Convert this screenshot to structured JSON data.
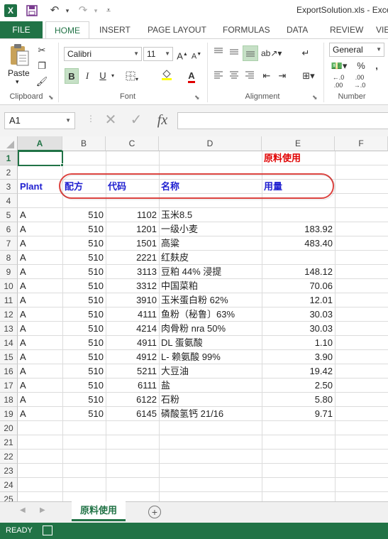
{
  "app": {
    "logo_text": "X",
    "title": "ExportSolution.xls - Excel"
  },
  "ribbon_tabs": [
    "FILE",
    "HOME",
    "INSERT",
    "PAGE LAYOUT",
    "FORMULAS",
    "DATA",
    "REVIEW",
    "VIEW"
  ],
  "ribbon": {
    "clipboard": {
      "label": "Clipboard",
      "paste": "Paste"
    },
    "font": {
      "label": "Font",
      "name": "Calibri",
      "size": "11",
      "bold": "B",
      "italic": "I",
      "underline": "U"
    },
    "alignment": {
      "label": "Alignment"
    },
    "number": {
      "label": "Number",
      "format": "General",
      "percent": "%",
      "comma": ","
    }
  },
  "formula_bar": {
    "name_box": "A1",
    "fx": "fx",
    "value": ""
  },
  "columns": [
    "A",
    "B",
    "C",
    "D",
    "E",
    "F"
  ],
  "rows": [
    "1",
    "2",
    "3",
    "4",
    "5",
    "6",
    "7",
    "8",
    "9",
    "10",
    "11",
    "12",
    "13",
    "14",
    "15",
    "16",
    "17",
    "18",
    "19",
    "20",
    "21",
    "22",
    "23",
    "24",
    "25"
  ],
  "sheet": {
    "e1": "原料使用",
    "headers": {
      "plant": "Plant",
      "formula": "配方",
      "code": "代码",
      "name": "名称",
      "usage": "用量"
    },
    "data": [
      {
        "plant": "A",
        "formula": "510",
        "code": "1102",
        "name": "玉米8.5",
        "usage": ""
      },
      {
        "plant": "A",
        "formula": "510",
        "code": "1201",
        "name": "一级小麦",
        "usage": "183.92"
      },
      {
        "plant": "A",
        "formula": "510",
        "code": "1501",
        "name": "高粱",
        "usage": "483.40"
      },
      {
        "plant": "A",
        "formula": "510",
        "code": "2221",
        "name": "红麸皮",
        "usage": ""
      },
      {
        "plant": "A",
        "formula": "510",
        "code": "3113",
        "name": "豆粕 44% 浸提",
        "usage": "148.12"
      },
      {
        "plant": "A",
        "formula": "510",
        "code": "3312",
        "name": "中国菜粕",
        "usage": "70.06"
      },
      {
        "plant": "A",
        "formula": "510",
        "code": "3910",
        "name": "玉米蛋白粉 62%",
        "usage": "12.01"
      },
      {
        "plant": "A",
        "formula": "510",
        "code": "4111",
        "name": "鱼粉（秘鲁〕63%",
        "usage": "30.03"
      },
      {
        "plant": "A",
        "formula": "510",
        "code": "4214",
        "name": "肉骨粉 nra 50%",
        "usage": "30.03"
      },
      {
        "plant": "A",
        "formula": "510",
        "code": "4911",
        "name": "DL 蛋氨酸",
        "usage": "1.10"
      },
      {
        "plant": "A",
        "formula": "510",
        "code": "4912",
        "name": "L- 赖氨酸 99%",
        "usage": "3.90"
      },
      {
        "plant": "A",
        "formula": "510",
        "code": "5211",
        "name": "大豆油",
        "usage": "19.42"
      },
      {
        "plant": "A",
        "formula": "510",
        "code": "6111",
        "name": "盐",
        "usage": "2.50"
      },
      {
        "plant": "A",
        "formula": "510",
        "code": "6122",
        "name": "石粉",
        "usage": "5.80"
      },
      {
        "plant": "A",
        "formula": "510",
        "code": "6145",
        "name": "磷酸氢钙 21/16",
        "usage": "9.71"
      }
    ]
  },
  "sheet_tab": "原料使用",
  "status": "READY",
  "colors": {
    "excel_green": "#217346",
    "header_blue": "#1f1fd0",
    "header_red": "#e00000",
    "oval_red": "#d9302c"
  }
}
